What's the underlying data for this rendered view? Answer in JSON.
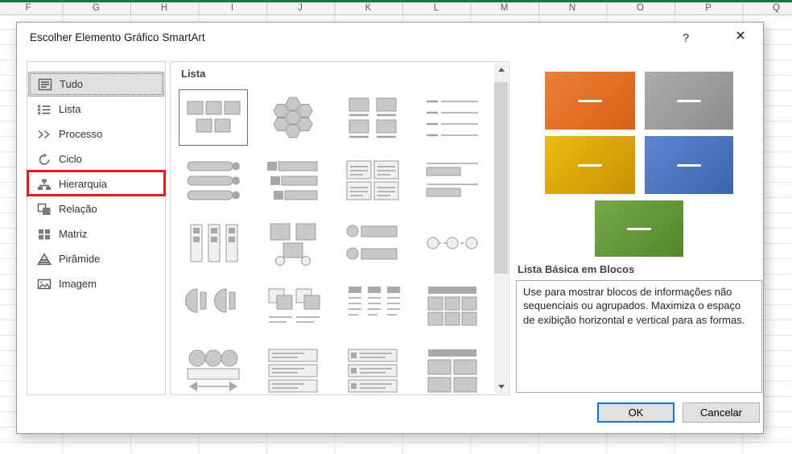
{
  "excel": {
    "column_headers": [
      "F",
      "G",
      "H",
      "I",
      "J",
      "K",
      "L",
      "M",
      "N",
      "O",
      "P",
      "Q"
    ]
  },
  "dialog": {
    "title": "Escolher Elemento Gráfico SmartArt",
    "help_label": "?",
    "close_label": "×"
  },
  "categories": {
    "items": [
      {
        "label": "Tudo",
        "selected": true
      },
      {
        "label": "Lista"
      },
      {
        "label": "Processo"
      },
      {
        "label": "Ciclo"
      },
      {
        "label": "Hierarquia",
        "highlighted": true
      },
      {
        "label": "Relação"
      },
      {
        "label": "Matriz"
      },
      {
        "label": "Pirâmide"
      },
      {
        "label": "Imagem"
      }
    ]
  },
  "gallery": {
    "header": "Lista"
  },
  "preview": {
    "title": "Lista Básica em Blocos",
    "description": "Use para mostrar blocos de informações não sequenciais ou agrupados. Maximiza o espaço de exibição horizontal e vertical para as formas.",
    "block_colors": {
      "orange": "#E2701B",
      "gray": "#9C9C9C",
      "gold": "#DDA304",
      "blue": "#4A74BF",
      "green": "#63982F"
    }
  },
  "footer": {
    "ok_label": "OK",
    "cancel_label": "Cancelar"
  },
  "annotations": {
    "highlight_color": "#E31B1C"
  }
}
